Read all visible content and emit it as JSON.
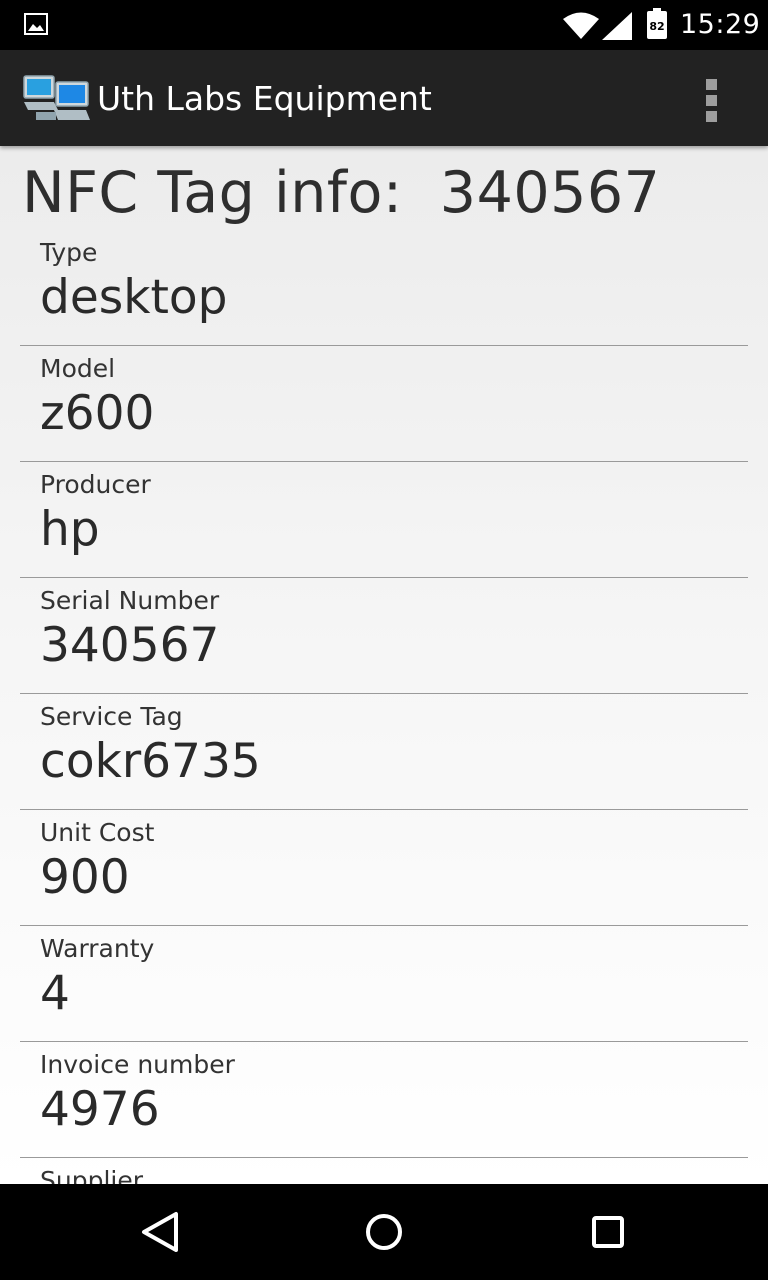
{
  "status_bar": {
    "time": "15:29",
    "battery_level": "82",
    "icons": [
      "gallery-icon",
      "wifi-icon",
      "signal-icon",
      "battery-icon"
    ]
  },
  "action_bar": {
    "title": "Uth Labs Equipment",
    "app_icon": "computers-icon",
    "overflow_icon": "overflow-menu-icon",
    "background": "#222222"
  },
  "page": {
    "title": "NFC Tag info:  340567",
    "fields": [
      {
        "label": "Type",
        "value": "desktop"
      },
      {
        "label": "Model",
        "value": "z600"
      },
      {
        "label": "Producer",
        "value": "hp"
      },
      {
        "label": "Serial Number",
        "value": "340567"
      },
      {
        "label": "Service Tag",
        "value": "cokr6735"
      },
      {
        "label": "Unit Cost",
        "value": "900"
      },
      {
        "label": "Warranty",
        "value": "4"
      },
      {
        "label": "Invoice number",
        "value": "4976"
      },
      {
        "label": "Supplier",
        "value": ""
      }
    ]
  },
  "nav_bar": {
    "icons": [
      "back-icon",
      "home-icon",
      "recents-icon"
    ]
  }
}
